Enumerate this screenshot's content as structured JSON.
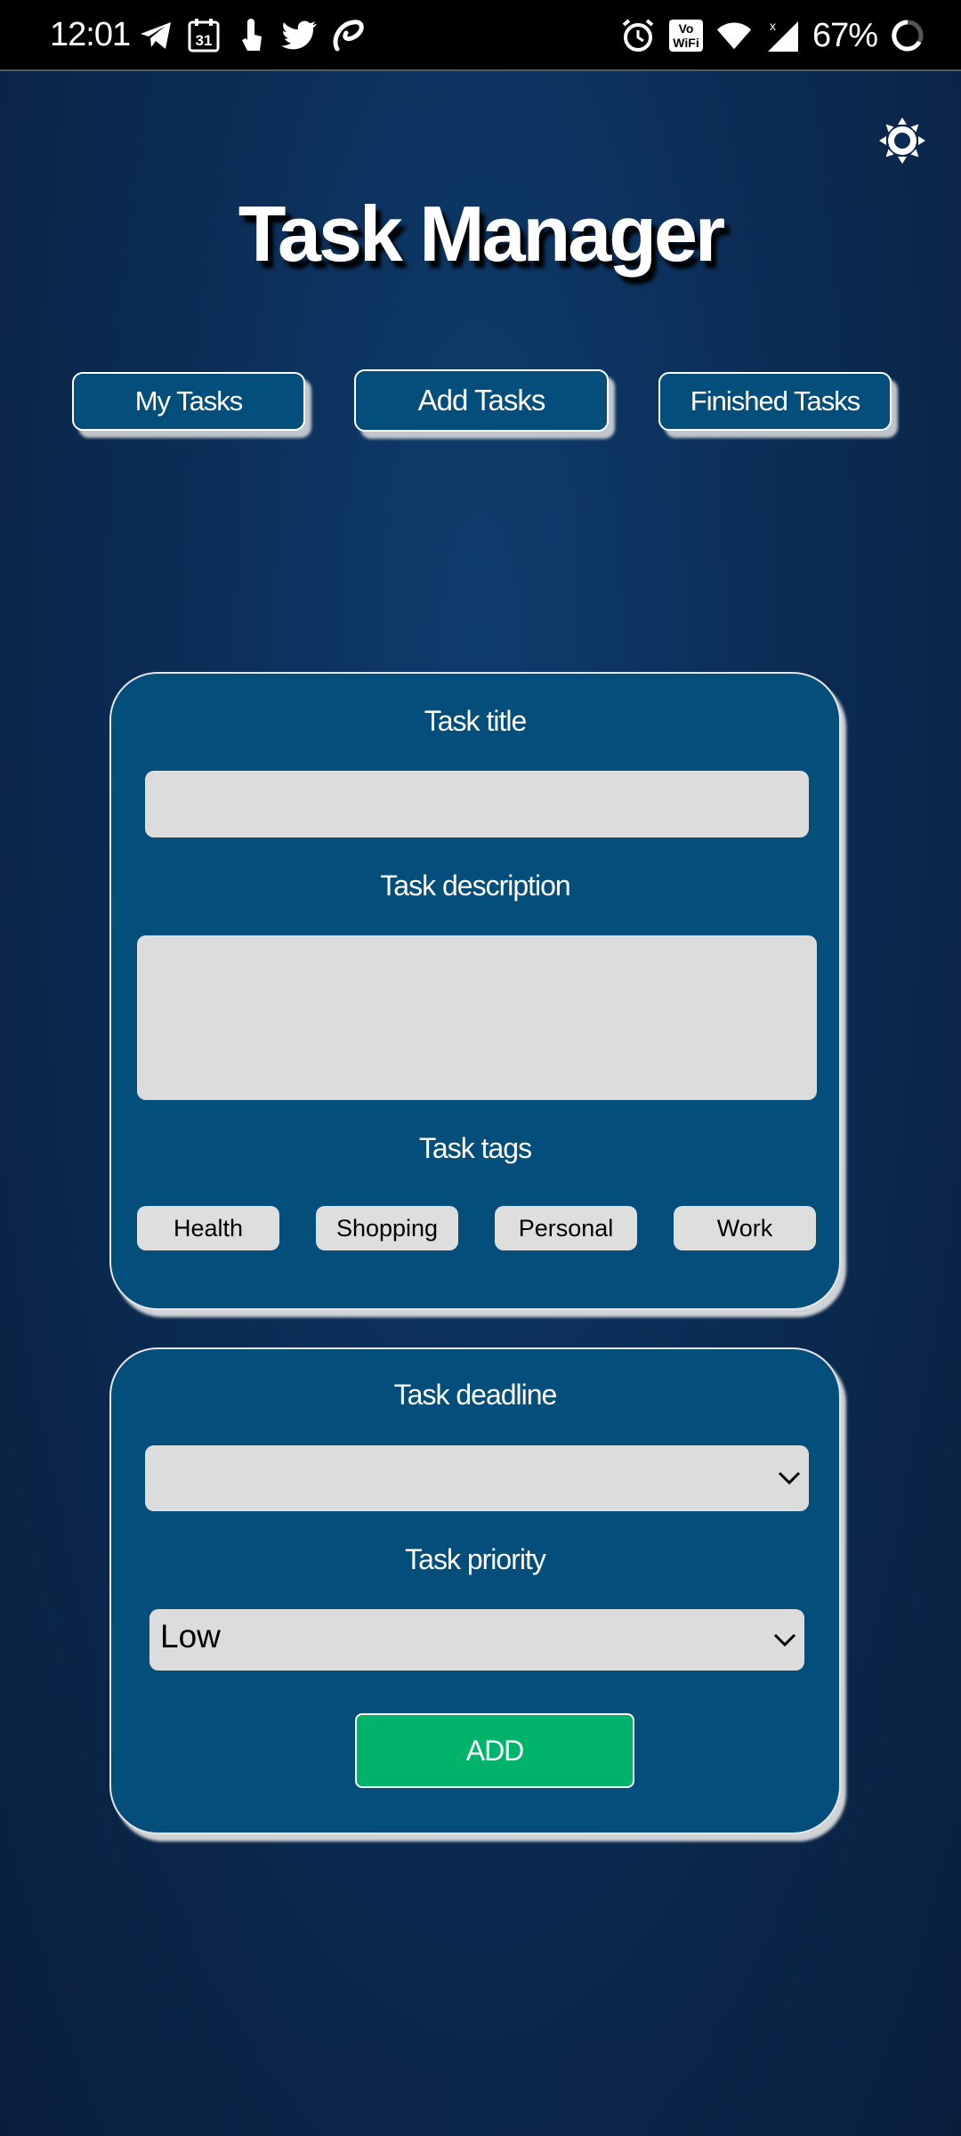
{
  "status_bar": {
    "time": "12:01",
    "calendar_day": "31",
    "vowifi_line1": "Vo",
    "vowifi_line2": "WiFi",
    "battery": "67%",
    "icons": [
      "telegram-icon",
      "calendar-icon",
      "touch-icon",
      "twitter-icon",
      "airtel-icon",
      "alarm-icon",
      "vowifi-icon",
      "wifi-icon",
      "signal-icon",
      "battery-icon"
    ]
  },
  "header": {
    "title": "Task Manager",
    "settings_icon": "sun-gear-icon"
  },
  "nav": {
    "my_tasks": "My Tasks",
    "add_tasks": "Add Tasks",
    "finished_tasks": "Finished Tasks"
  },
  "form": {
    "title_label": "Task title",
    "title_value": "",
    "description_label": "Task description",
    "description_value": "",
    "tags_label": "Task tags",
    "tags": [
      "Health",
      "Shopping",
      "Personal",
      "Work"
    ],
    "deadline_label": "Task deadline",
    "deadline_value": "",
    "priority_label": "Task priority",
    "priority_value": "Low",
    "add_button": "ADD"
  },
  "colors": {
    "background": "#0b2c55",
    "card": "#034e7a",
    "field": "#dcdcdc",
    "add_button": "#00b36b"
  }
}
